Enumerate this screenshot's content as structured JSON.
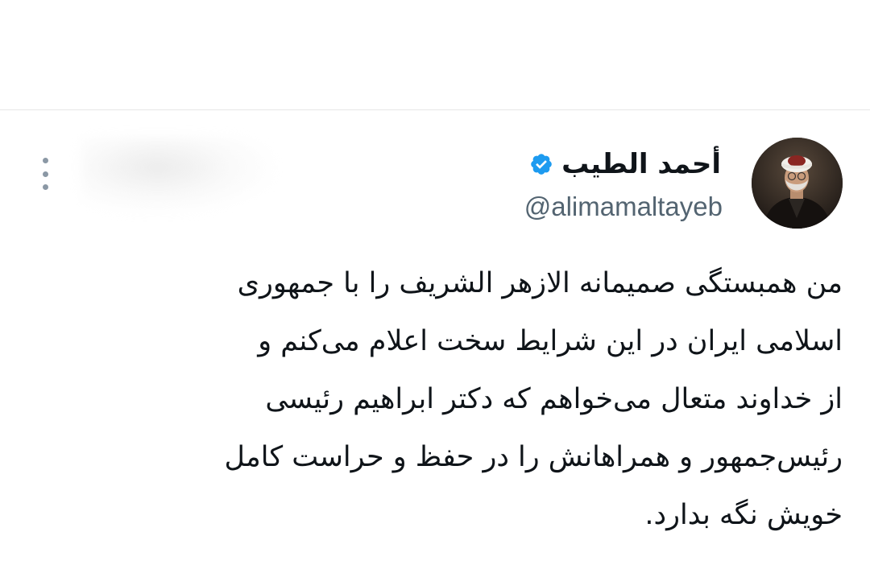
{
  "tweet": {
    "author": {
      "display_name": "أحمد الطيب",
      "handle": "@alimamaltayeb",
      "verified_icon": "verified-badge-icon",
      "avatar_icon": "profile-avatar"
    },
    "more_icon": "more-options-icon",
    "body_lines": [
      "من همبستگی صمیمانه الازهر الشریف را با جمهوری",
      "اسلامی ایران در این شرایط سخت اعلام می‌کنم و",
      "از خداوند متعال می‌خواهم که دکتر ابراهیم رئیسی",
      "رئیس‌جمهور و همراهانش را در حفظ و حراست کامل",
      "خویش نگه بدارد."
    ]
  },
  "colors": {
    "verified": "#1d9bf0",
    "secondary_text": "#536471",
    "primary_text": "#0f1419",
    "divider": "#e6e6e6"
  }
}
